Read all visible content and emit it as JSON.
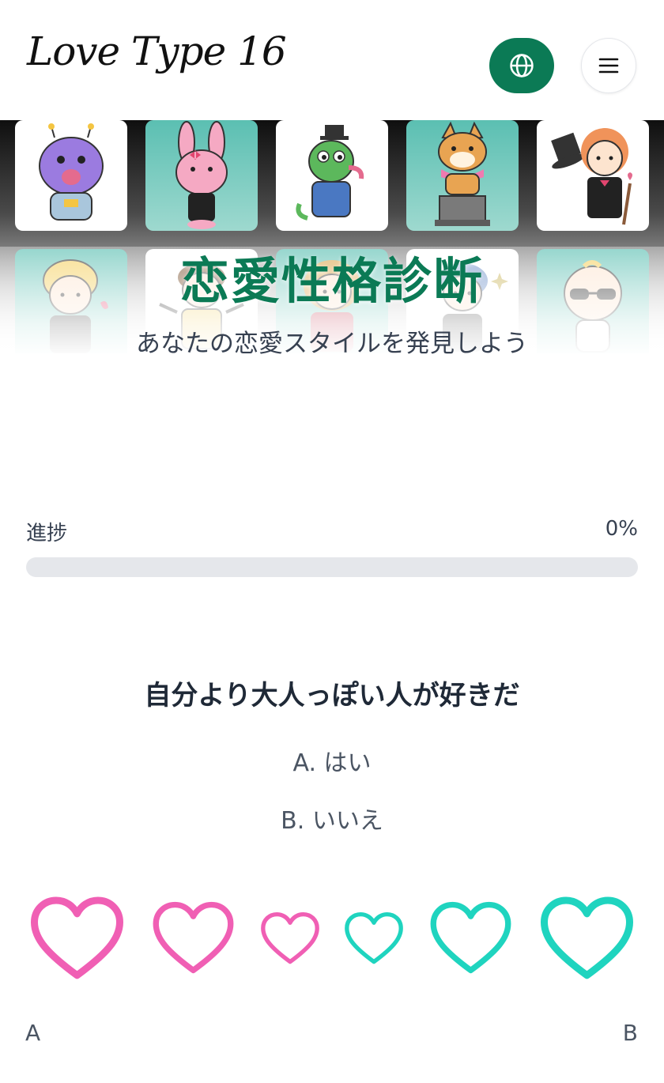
{
  "header": {
    "logo_text": "Love Type 16",
    "language_icon": "globe-icon",
    "menu_icon": "hamburger-menu-icon"
  },
  "hero": {
    "title": "恋愛性格診断",
    "subtitle": "あなたの恋愛スタイルを発見しよう",
    "characters": [
      "purple-alien-character",
      "pink-bunny-character",
      "green-chameleon-character",
      "shiba-dog-character",
      "magician-girl-character",
      "blonde-boy-character",
      "suit-man-character",
      "red-hair-girl-character",
      "blue-hair-boy-character",
      "sunglasses-baby-character"
    ]
  },
  "progress": {
    "label": "進捗",
    "value_text": "0%",
    "value": 0
  },
  "question": {
    "text": "自分より大人っぽい人が好きだ",
    "option_a": "A. はい",
    "option_b": "B. いいえ"
  },
  "scale": {
    "label_a": "A",
    "label_b": "B",
    "hearts": [
      "heart-icon",
      "heart-icon",
      "heart-icon",
      "heart-icon",
      "heart-icon",
      "heart-icon"
    ]
  },
  "colors": {
    "brand_green": "#0b7a55",
    "heart_pink": "#f05fb4",
    "heart_teal": "#1fd4bf",
    "track_gray": "#e5e7eb"
  }
}
